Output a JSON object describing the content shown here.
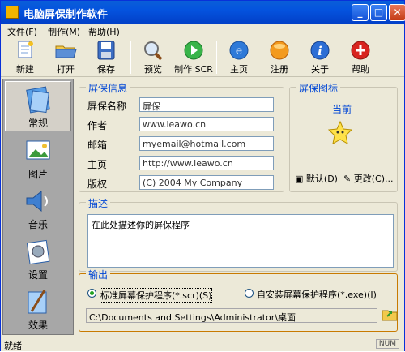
{
  "window": {
    "title": "电脑屏保制作软件"
  },
  "titlebar_buttons": {
    "minimize": "_",
    "maximize": "□",
    "close": "✕"
  },
  "menu": [
    {
      "label": "文件",
      "accel": "(F)"
    },
    {
      "label": "制作",
      "accel": "(M)"
    },
    {
      "label": "帮助",
      "accel": "(H)"
    }
  ],
  "toolbar": [
    {
      "label": "新建",
      "icon": "new-doc-icon"
    },
    {
      "label": "打开",
      "icon": "open-folder-icon"
    },
    {
      "label": "保存",
      "icon": "save-disk-icon"
    },
    {
      "label": "预览",
      "icon": "magnifier-icon"
    },
    {
      "label": "制作 SCR",
      "icon": "play-arrow-icon"
    },
    {
      "label": "主页",
      "icon": "ie-globe-icon"
    },
    {
      "label": "注册",
      "icon": "orange-ball-icon"
    },
    {
      "label": "关于",
      "icon": "info-icon"
    },
    {
      "label": "帮助",
      "icon": "help-plus-icon"
    }
  ],
  "sidebar": [
    {
      "label": "常规",
      "icon": "general-icon",
      "selected": true
    },
    {
      "label": "图片",
      "icon": "pictures-icon"
    },
    {
      "label": "音乐",
      "icon": "music-icon"
    },
    {
      "label": "设置",
      "icon": "settings-icon"
    },
    {
      "label": "效果",
      "icon": "effects-icon"
    }
  ],
  "info_group": {
    "title": "屏保信息",
    "fields": [
      {
        "label": "屏保名称",
        "value": "屏保"
      },
      {
        "label": "作者",
        "value": "www.leawo.cn"
      },
      {
        "label": "邮箱",
        "value": "myemail@hotmail.com"
      },
      {
        "label": "主页",
        "value": "http://www.leawo.cn"
      },
      {
        "label": "版权",
        "value": "(C) 2004 My Company"
      }
    ]
  },
  "icon_group": {
    "title": "屏保图标",
    "current_label": "当前",
    "default_btn": "默认(D)",
    "change_btn": "更改(C)..."
  },
  "desc_group": {
    "title": "描述",
    "text": "在此处描述你的屏保程序"
  },
  "output_group": {
    "title": "输出",
    "options": [
      {
        "label": "标准屏幕保护程序(*.scr)(S)",
        "selected": true
      },
      {
        "label": "自安装屏幕保护程序(*.exe)(I)",
        "selected": false
      }
    ],
    "path": "C:\\Documents and Settings\\Administrator\\桌面"
  },
  "status": {
    "text": "就绪",
    "num": "NUM"
  },
  "colors": {
    "accent": "#0046d5",
    "titlebar": "#0453de",
    "output_border": "#c87a00"
  }
}
